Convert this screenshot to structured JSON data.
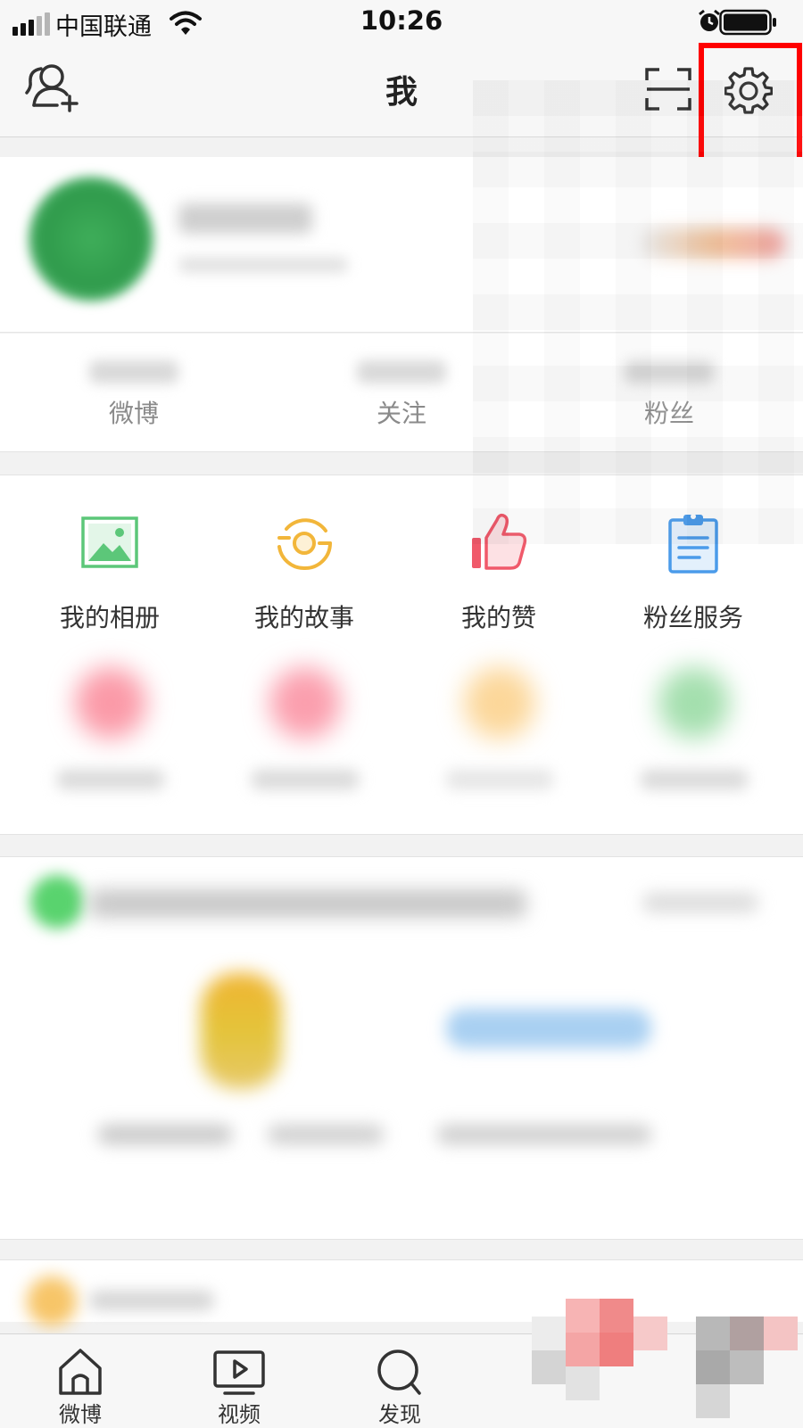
{
  "status_bar": {
    "carrier": "中国联通",
    "time": "10:26"
  },
  "nav_bar": {
    "title": "我"
  },
  "stats": [
    {
      "label": "微博"
    },
    {
      "label": "关注"
    },
    {
      "label": "粉丝"
    }
  ],
  "tools": [
    {
      "label": "我的相册",
      "icon": "photo-album-icon",
      "color": "#5cc779"
    },
    {
      "label": "我的故事",
      "icon": "story-icon",
      "color": "#f2b63a"
    },
    {
      "label": "我的赞",
      "icon": "thumbs-up-icon",
      "color": "#f0596a"
    },
    {
      "label": "粉丝服务",
      "icon": "clipboard-icon",
      "color": "#4a9bea"
    }
  ],
  "tab_bar": {
    "tabs": [
      {
        "label": "微博",
        "icon": "home-icon"
      },
      {
        "label": "视频",
        "icon": "video-icon"
      },
      {
        "label": "发现",
        "icon": "search-icon"
      }
    ]
  },
  "colors": {
    "highlight": "#ff0000",
    "background": "#f2f2f2"
  }
}
